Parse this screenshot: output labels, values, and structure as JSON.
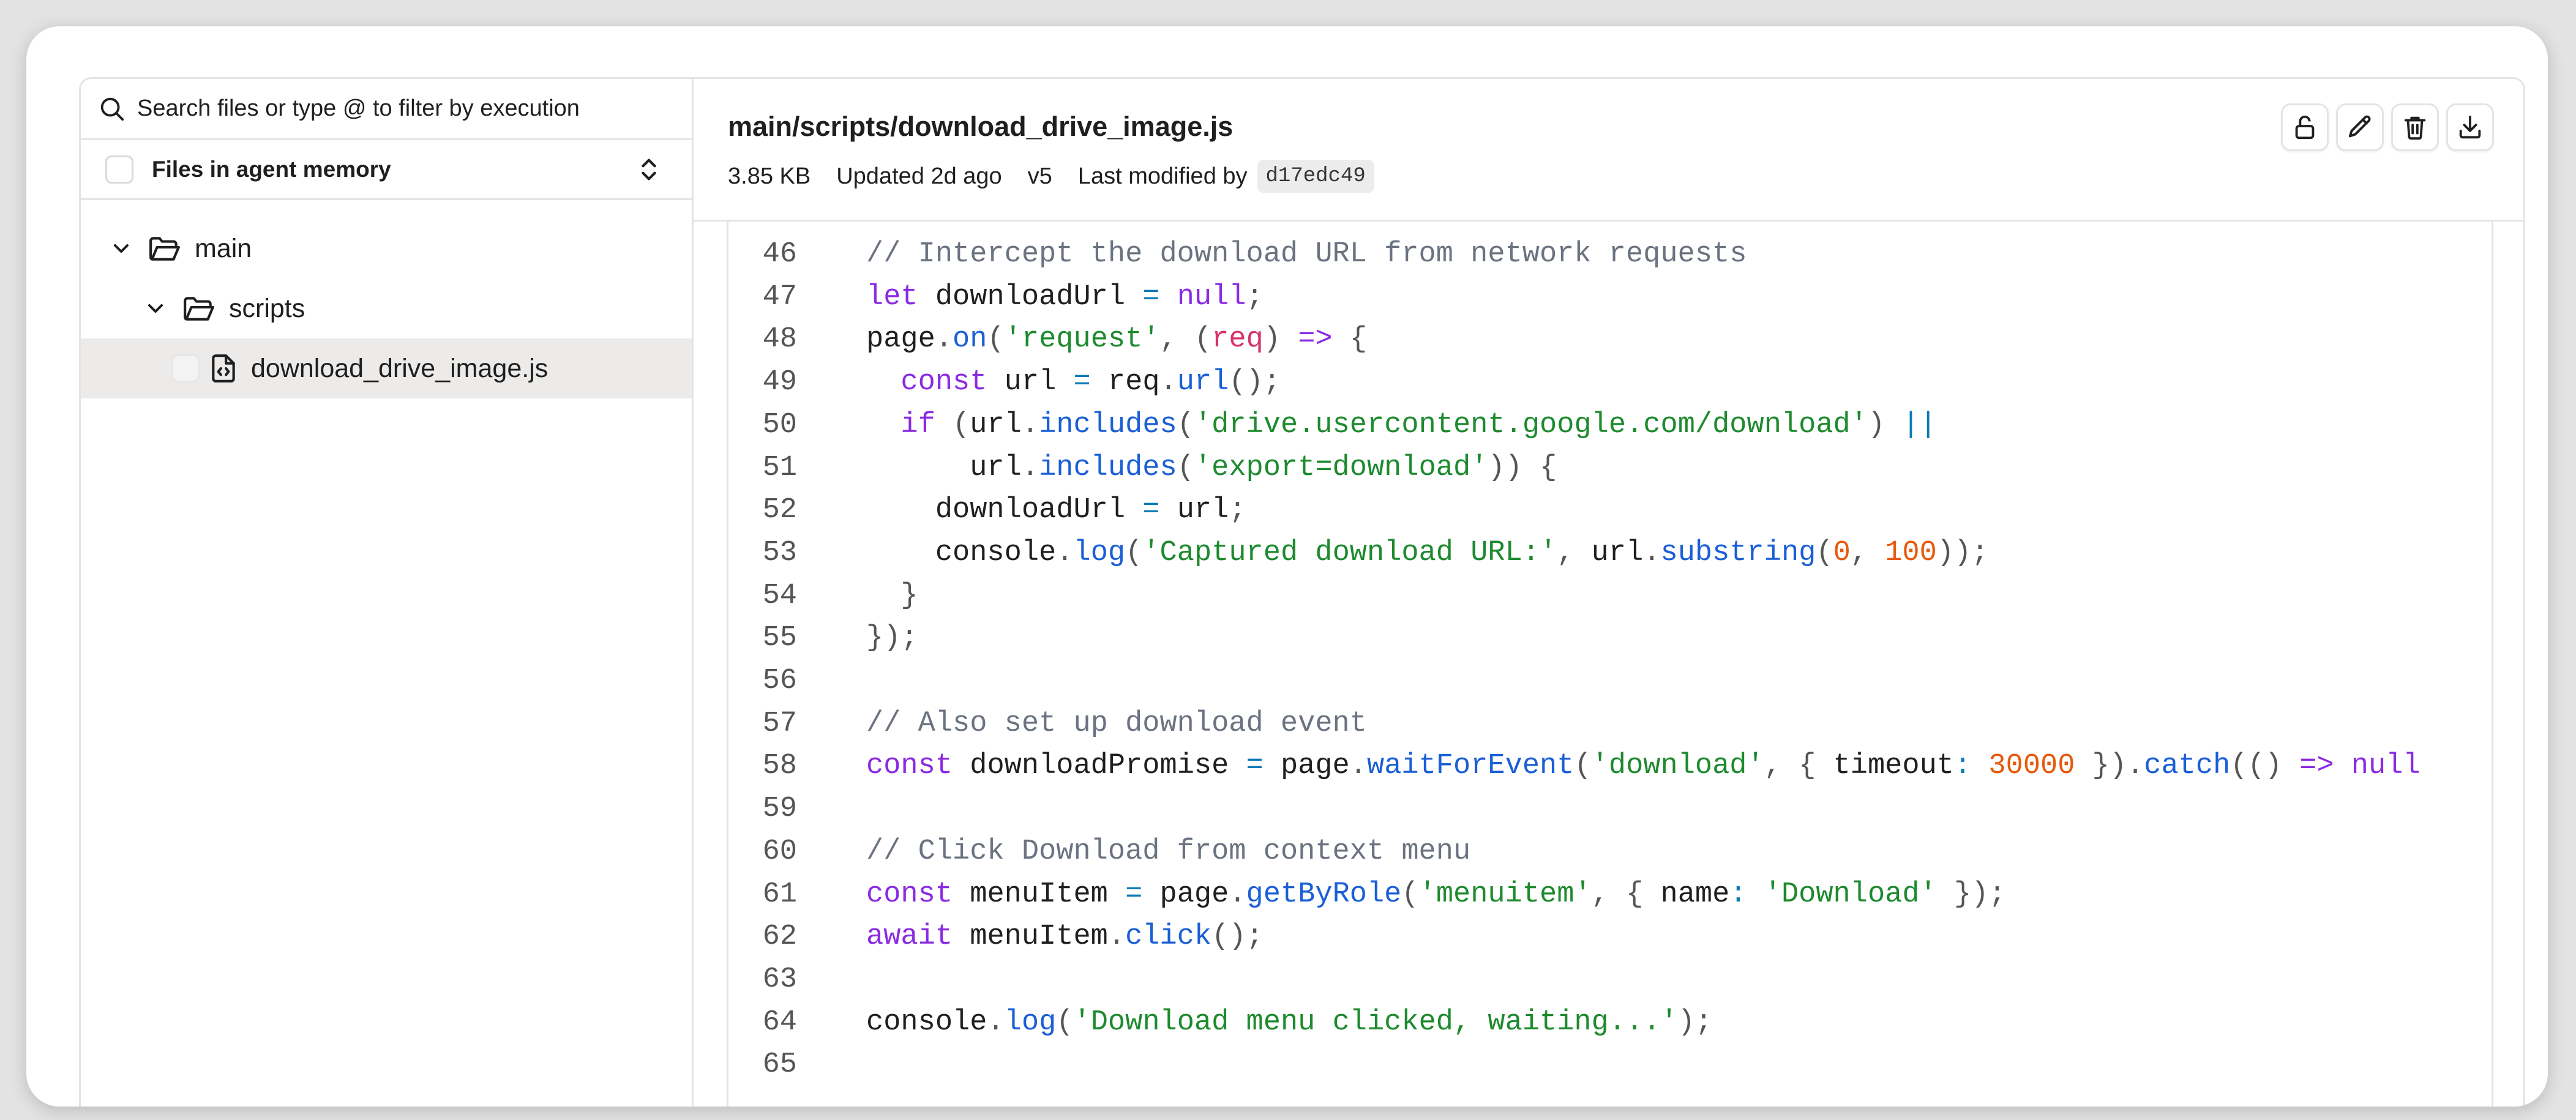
{
  "sidebar": {
    "search_placeholder": "Search files or type @ to filter by execution",
    "memory_filter_label": "Files in agent memory",
    "tree": [
      {
        "label": "main",
        "type": "folder",
        "depth": 0,
        "expanded": true,
        "selected": false
      },
      {
        "label": "scripts",
        "type": "folder",
        "depth": 1,
        "expanded": true,
        "selected": false
      },
      {
        "label": "download_drive_image.js",
        "type": "file",
        "depth": 2,
        "selected": true
      }
    ]
  },
  "file": {
    "path": "main/scripts/download_drive_image.js",
    "size": "3.85 KB",
    "updated": "Updated 2d ago",
    "version": "v5",
    "modified_label": "Last modified by",
    "commit": "d17edc49"
  },
  "actions": [
    {
      "name": "lock",
      "icon": "lock-icon"
    },
    {
      "name": "edit",
      "icon": "pencil-icon"
    },
    {
      "name": "delete",
      "icon": "trash-icon"
    },
    {
      "name": "download",
      "icon": "download-icon"
    }
  ],
  "colors": {
    "comment": "#6b7280",
    "keyword": "#8a2be2",
    "string": "#1d8a2e",
    "function": "#1a5fd6",
    "number": "#e8590c",
    "param": "#d6336c",
    "operator": "#0b7bb8"
  },
  "code_lines": [
    {
      "n": "46",
      "tokens": [
        [
          "c",
          "// Intercept the download URL from network requests"
        ]
      ]
    },
    {
      "n": "47",
      "tokens": [
        [
          "k",
          "let"
        ],
        [
          "i",
          " downloadUrl "
        ],
        [
          "o",
          "="
        ],
        [
          "k",
          " null"
        ],
        [
          "b",
          ";"
        ]
      ]
    },
    {
      "n": "48",
      "tokens": [
        [
          "i",
          "page"
        ],
        [
          "b",
          "."
        ],
        [
          "f",
          "on"
        ],
        [
          "b",
          "("
        ],
        [
          "s",
          "'request'"
        ],
        [
          "b",
          ", ("
        ],
        [
          "p",
          "req"
        ],
        [
          "b",
          ") "
        ],
        [
          "k",
          "=>"
        ],
        [
          "b",
          " {"
        ]
      ]
    },
    {
      "n": "49",
      "tokens": [
        [
          "i",
          "  "
        ],
        [
          "k",
          "const"
        ],
        [
          "i",
          " url "
        ],
        [
          "o",
          "="
        ],
        [
          "i",
          " req"
        ],
        [
          "b",
          "."
        ],
        [
          "f",
          "url"
        ],
        [
          "b",
          "();"
        ]
      ]
    },
    {
      "n": "50",
      "tokens": [
        [
          "i",
          "  "
        ],
        [
          "k",
          "if"
        ],
        [
          "b",
          " ("
        ],
        [
          "i",
          "url"
        ],
        [
          "b",
          "."
        ],
        [
          "f",
          "includes"
        ],
        [
          "b",
          "("
        ],
        [
          "s",
          "'drive.usercontent.google.com/download'"
        ],
        [
          "b",
          ") "
        ],
        [
          "o",
          "||"
        ]
      ]
    },
    {
      "n": "51",
      "tokens": [
        [
          "i",
          "      url"
        ],
        [
          "b",
          "."
        ],
        [
          "f",
          "includes"
        ],
        [
          "b",
          "("
        ],
        [
          "s",
          "'export=download'"
        ],
        [
          "b",
          ")) {"
        ]
      ]
    },
    {
      "n": "52",
      "tokens": [
        [
          "i",
          "    downloadUrl "
        ],
        [
          "o",
          "="
        ],
        [
          "i",
          " url"
        ],
        [
          "b",
          ";"
        ]
      ]
    },
    {
      "n": "53",
      "tokens": [
        [
          "i",
          "    console"
        ],
        [
          "b",
          "."
        ],
        [
          "f",
          "log"
        ],
        [
          "b",
          "("
        ],
        [
          "s",
          "'Captured download URL:'"
        ],
        [
          "b",
          ", "
        ],
        [
          "i",
          "url"
        ],
        [
          "b",
          "."
        ],
        [
          "f",
          "substring"
        ],
        [
          "b",
          "("
        ],
        [
          "n",
          "0"
        ],
        [
          "b",
          ", "
        ],
        [
          "n",
          "100"
        ],
        [
          "b",
          "));"
        ]
      ]
    },
    {
      "n": "54",
      "tokens": [
        [
          "b",
          "  }"
        ]
      ]
    },
    {
      "n": "55",
      "tokens": [
        [
          "b",
          "});"
        ]
      ]
    },
    {
      "n": "56",
      "tokens": []
    },
    {
      "n": "57",
      "tokens": [
        [
          "c",
          "// Also set up download event"
        ]
      ]
    },
    {
      "n": "58",
      "tokens": [
        [
          "k",
          "const"
        ],
        [
          "i",
          " downloadPromise "
        ],
        [
          "o",
          "="
        ],
        [
          "i",
          " page"
        ],
        [
          "b",
          "."
        ],
        [
          "f",
          "waitForEvent"
        ],
        [
          "b",
          "("
        ],
        [
          "s",
          "'download'"
        ],
        [
          "b",
          ", { "
        ],
        [
          "i",
          "timeout"
        ],
        [
          "o",
          ":"
        ],
        [
          "n",
          " 30000"
        ],
        [
          "b",
          " })."
        ],
        [
          "f",
          "catch"
        ],
        [
          "b",
          "(() "
        ],
        [
          "k",
          "=>"
        ],
        [
          "k",
          " null"
        ]
      ]
    },
    {
      "n": "59",
      "tokens": []
    },
    {
      "n": "60",
      "tokens": [
        [
          "c",
          "// Click Download from context menu"
        ]
      ]
    },
    {
      "n": "61",
      "tokens": [
        [
          "k",
          "const"
        ],
        [
          "i",
          " menuItem "
        ],
        [
          "o",
          "="
        ],
        [
          "i",
          " page"
        ],
        [
          "b",
          "."
        ],
        [
          "f",
          "getByRole"
        ],
        [
          "b",
          "("
        ],
        [
          "s",
          "'menuitem'"
        ],
        [
          "b",
          ", { "
        ],
        [
          "i",
          "name"
        ],
        [
          "o",
          ":"
        ],
        [
          "s",
          " 'Download'"
        ],
        [
          "b",
          " });"
        ]
      ]
    },
    {
      "n": "62",
      "tokens": [
        [
          "k",
          "await"
        ],
        [
          "i",
          " menuItem"
        ],
        [
          "b",
          "."
        ],
        [
          "f",
          "click"
        ],
        [
          "b",
          "();"
        ]
      ]
    },
    {
      "n": "63",
      "tokens": []
    },
    {
      "n": "64",
      "tokens": [
        [
          "i",
          "console"
        ],
        [
          "b",
          "."
        ],
        [
          "f",
          "log"
        ],
        [
          "b",
          "("
        ],
        [
          "s",
          "'Download menu clicked, waiting...'"
        ],
        [
          "b",
          ");"
        ]
      ]
    },
    {
      "n": "65",
      "tokens": []
    }
  ]
}
